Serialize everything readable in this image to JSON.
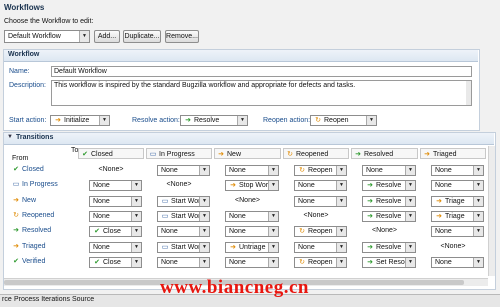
{
  "panel": {
    "title": "Workflows",
    "choose_label": "Choose the Workflow to edit:",
    "selected_workflow": "Default Workflow",
    "buttons": {
      "add": "Add...",
      "duplicate": "Duplicate...",
      "remove": "Remove..."
    }
  },
  "workflow": {
    "section_title": "Workflow",
    "name_label": "Name:",
    "name_value": "Default Workflow",
    "description_label": "Description:",
    "description_value": "This workflow is inspired by the standard Bugzilla workflow and appropriate for defects and tasks.",
    "start_action_label": "Start action:",
    "start_action_value": "Initialize",
    "resolve_action_label": "Resolve action:",
    "resolve_action_value": "Resolve",
    "reopen_action_label": "Reopen action:",
    "reopen_action_value": "Reopen"
  },
  "transitions": {
    "section_title": "Transitions",
    "from_label": "From",
    "to_label": "To",
    "columns": [
      {
        "label": "Closed",
        "icon": "check-icon"
      },
      {
        "label": "In Progress",
        "icon": "in-progress-icon"
      },
      {
        "label": "New",
        "icon": "new-arrow-icon"
      },
      {
        "label": "Reopened",
        "icon": "reopen-icon"
      },
      {
        "label": "Resolved",
        "icon": "resolved-arrow-icon"
      },
      {
        "label": "Triaged",
        "icon": "triage-arrow-icon"
      }
    ],
    "rows": [
      {
        "label": "Closed",
        "icon": "check-icon",
        "cells": [
          "<None>",
          "None",
          "None",
          "Reopen",
          "None",
          "None"
        ]
      },
      {
        "label": "In Progress",
        "icon": "in-progress-icon",
        "cells": [
          "None",
          "<None>",
          "Stop Working",
          "None",
          "Resolve",
          "None"
        ]
      },
      {
        "label": "New",
        "icon": "new-arrow-icon",
        "cells": [
          "None",
          "Start Working",
          "<None>",
          "None",
          "Resolve",
          "Triage"
        ]
      },
      {
        "label": "Reopened",
        "icon": "reopen-icon",
        "cells": [
          "None",
          "Start Working",
          "None",
          "<None>",
          "Resolve",
          "Triage"
        ]
      },
      {
        "label": "Resolved",
        "icon": "resolved-arrow-icon",
        "cells": [
          "Close",
          "None",
          "None",
          "Reopen",
          "<None>",
          "None"
        ]
      },
      {
        "label": "Triaged",
        "icon": "triage-arrow-icon",
        "cells": [
          "None",
          "Start Working",
          "Untriage",
          "None",
          "Resolve",
          "<None>"
        ]
      },
      {
        "label": "Verified",
        "icon": "verified-icon",
        "cells": [
          "Close",
          "None",
          "None",
          "Reopen",
          "Set Resolved",
          "None"
        ]
      }
    ]
  },
  "bottom_tabs": [
    "rce",
    "Process Iterations Source"
  ],
  "watermark": "www.biancneg.cn"
}
